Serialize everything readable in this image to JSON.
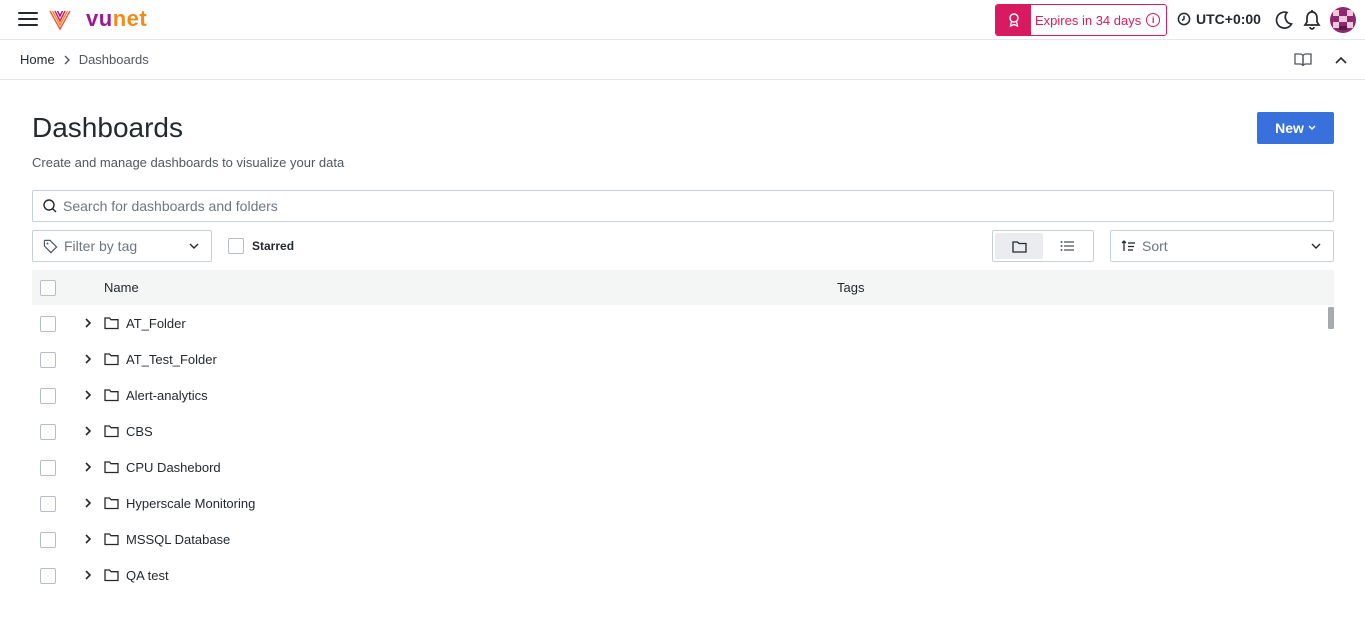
{
  "app": {
    "brand_prefix": "vu",
    "brand_suffix": "net",
    "brand_colors": {
      "vu": "#9b1c8f",
      "net": "#f28a1c"
    }
  },
  "topbar": {
    "expires_label": "Expires in 34 days",
    "timezone": "UTC+0:00",
    "accent": "#d81b60"
  },
  "breadcrumb": {
    "home": "Home",
    "current": "Dashboards"
  },
  "header": {
    "title": "Dashboards",
    "subtitle": "Create and manage dashboards to visualize your data",
    "new_button": "New"
  },
  "search": {
    "placeholder": "Search for dashboards and folders",
    "value": ""
  },
  "filters": {
    "tag_placeholder": "Filter by tag",
    "starred_label": "Starred",
    "starred_checked": false,
    "view_mode": "folders",
    "sort_placeholder": "Sort"
  },
  "table": {
    "columns": {
      "name": "Name",
      "tags": "Tags"
    },
    "rows": [
      {
        "name": "AT_Folder",
        "type": "folder"
      },
      {
        "name": "AT_Test_Folder",
        "type": "folder"
      },
      {
        "name": "Alert-analytics",
        "type": "folder"
      },
      {
        "name": "CBS",
        "type": "folder"
      },
      {
        "name": "CPU Dashebord",
        "type": "folder"
      },
      {
        "name": "Hyperscale Monitoring",
        "type": "folder"
      },
      {
        "name": "MSSQL Database",
        "type": "folder"
      },
      {
        "name": "QA test",
        "type": "folder"
      }
    ]
  },
  "colors": {
    "primary_button": "#3871dc",
    "text": "#24292e",
    "muted_text": "#6e7681",
    "border": "#c7d0d9",
    "table_header_bg": "#f4f5f5"
  }
}
